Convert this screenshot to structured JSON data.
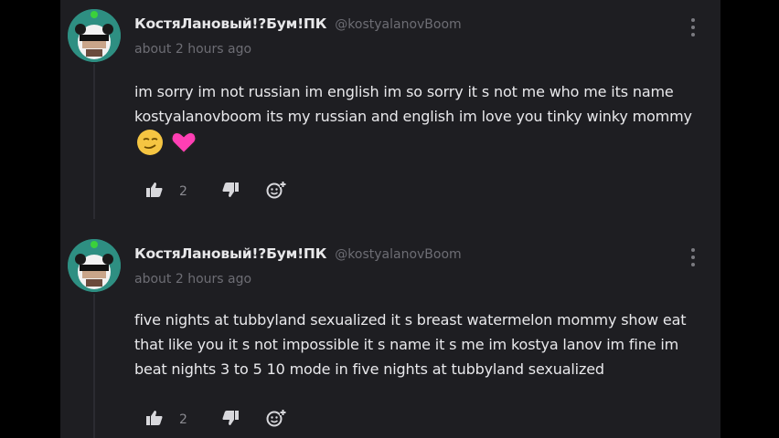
{
  "comments": [
    {
      "username": "КостяЛановый!?Бум!ПК",
      "handle": "@kostyalanovBoom",
      "time": "about 2 hours ago",
      "text": "im sorry im not russian im english im so sorry it s not me who me its name kostyalanovboom its my russian and english im love you tinky winky mommy",
      "likes": "2",
      "emojis": [
        "smirk-face-emoji",
        "pink-heart-emoji"
      ]
    },
    {
      "username": "КостяЛановый!?Бум!ПК",
      "handle": "@kostyalanovBoom",
      "time": "about 2 hours ago",
      "text": "five nights at tubbyland sexualized it s breast watermelon mommy show eat that like you it s not impossible it s name it s me im kostya lanov im fine im beat nights 3 to 5 10 mode in five nights at tubbyland sexualized",
      "likes": "2"
    }
  ],
  "colors": {
    "background": "#1e1e22",
    "text": "#e9e9ec",
    "muted": "#6d6d74",
    "avatar_bg": "#2e8f82"
  }
}
